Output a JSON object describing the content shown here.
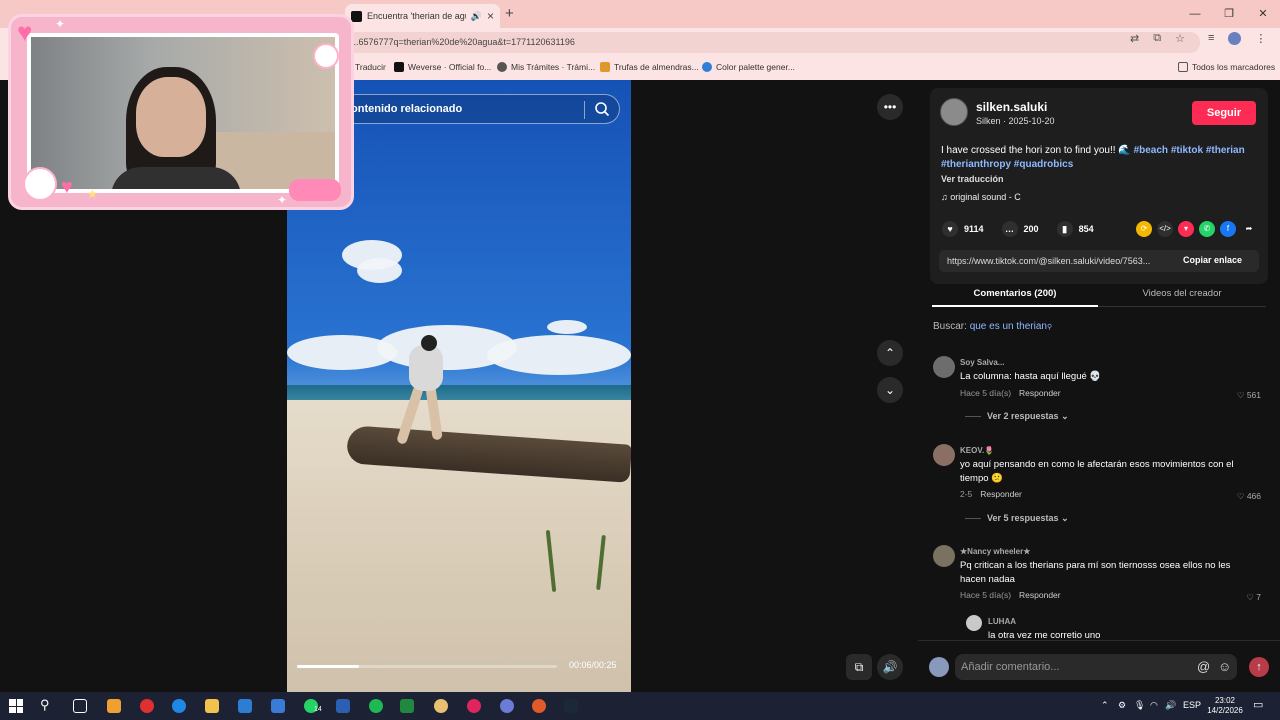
{
  "browser": {
    "active_tab_title": "Encuentra 'therian de agua'",
    "url": "...6576777q=therian%20de%20agua&t=1771120631196",
    "bookmarks": [
      "Traducir",
      "Weverse · Official fo...",
      "Mis Trámites · Trámi...",
      "Trufas de almendras...",
      "Color palette gener..."
    ],
    "all_bookmarks_label": "Todos los marcadores"
  },
  "video": {
    "related_search_label": "ontenido relacionado",
    "time": "00:06/00:25",
    "progress_fraction": 0.24
  },
  "post": {
    "username": "silken.saluki",
    "sub": "Silken · 2025-10-20",
    "follow_label": "Seguir",
    "description_text": "I have crossed the hori zon to find you!! 🌊",
    "hashtags": [
      "#beach",
      "#tiktok",
      "#therian",
      "#therianthropy",
      "#quadrobics"
    ],
    "translate_label": "Ver traducción",
    "sound": "original sound - C",
    "likes": "9114",
    "comments_count": "200",
    "saves": "854",
    "link": "https://www.tiktok.com/@silken.saluki/video/7563...",
    "copy_link_label": "Copiar enlace",
    "tab_comments": "Comentarios (200)",
    "tab_creator": "Videos del creador",
    "search_prefix": "Buscar:",
    "search_query": "que es un therian"
  },
  "comments": [
    {
      "name": "Soy Salva...",
      "text": "La columna: hasta aquí llegué 💀",
      "time": "Hace 5 día(s)",
      "reply": "Responder",
      "likes": "561",
      "replies": "Ver 2 respuestas"
    },
    {
      "name": "KEOV.🌷",
      "text": "yo aquí pensando en como le afectarán esos movimientos con el tiempo 😕",
      "time": "2-5",
      "reply": "Responder",
      "likes": "466",
      "replies": "Ver 5 respuestas"
    },
    {
      "name": "★Nancy wheeler★",
      "text": "Pq critican a los therians para mí son tiernosss osea ellos no les hacen nadaa",
      "time": "Hace 5 día(s)",
      "reply": "Responder",
      "likes": "7"
    },
    {
      "name": "LUHAA",
      "text": "la otra vez me corretio uno"
    }
  ],
  "add_comment_placeholder": "Añadir comentario...",
  "taskbar": {
    "lang": "ESP",
    "time": "23:02",
    "date": "14/2/2026",
    "whatsapp_badge": "14"
  },
  "colors": {
    "follow": "#fe2c55",
    "hashtag": "#8fb8ff",
    "chrome": "#f6c8c6"
  }
}
